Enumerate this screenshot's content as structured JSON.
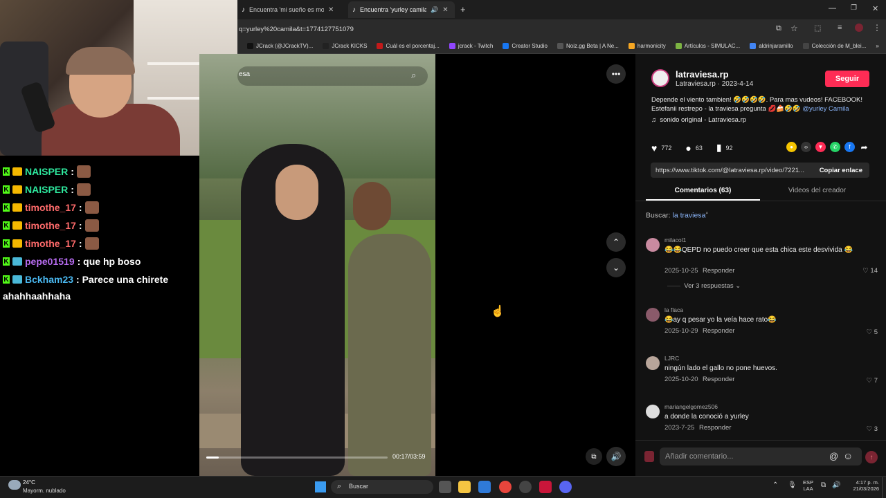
{
  "browser": {
    "tabs": [
      {
        "title": "Encuentra 'mi sueño es montar",
        "close": "✕"
      },
      {
        "title": "Encuentra 'yurley camila' en",
        "close": "✕"
      }
    ],
    "new_tab": "+",
    "url": "q=yurley%20camila&t=1774127751079",
    "bookmarks": [
      "JCrack (@JCrackTV)...",
      "JCrack KICKS",
      "Cuál es el porcentaj...",
      "jcrack - Twitch",
      "Creator Studio",
      "Noiz.gg Beta | A Ne...",
      "harmonicity",
      "Artículos - SIMULAC...",
      "aldrinjaramillo",
      "Colección de M_blei..."
    ],
    "bookmarks_more": "»"
  },
  "chat": {
    "messages": [
      {
        "user": "NAISPER",
        "color": "#2ee89e",
        "text": ":"
      },
      {
        "user": "NAISPER",
        "color": "#2ee89e",
        "text": ":"
      },
      {
        "user": "timothe_17",
        "color": "#ff6b6b",
        "text": ":"
      },
      {
        "user": "timothe_17",
        "color": "#ff6b6b",
        "text": ":"
      },
      {
        "user": "timothe_17",
        "color": "#ff6b6b",
        "text": ":"
      },
      {
        "user": "pepe01519",
        "color": "#b76cf0",
        "text": ": que hp boso"
      },
      {
        "user": "Bckham23",
        "color": "#4ab8f0",
        "text": ": Parece una chirete"
      }
    ],
    "continuation": "ahahhaahhaha"
  },
  "video": {
    "search_text": "esa",
    "time": "00:17/03:59",
    "progress": 0.07
  },
  "post": {
    "author": "latraviesa.rp",
    "author_meta": "Latraviesa.rp · 2023-4-14",
    "follow": "Seguir",
    "description": "Depende el viento tambien! 🤣🤣🤣🤣. Para mas vudeos! FACEBOOK! Estefanii restrepo - la traviesa pregunta 💋🍰🤣🤣",
    "mention": "@yurley Camila",
    "sound": "sonido original - Latraviesa.rp",
    "likes": "772",
    "comments": "63",
    "saves": "92",
    "link": "https://www.tiktok.com/@latraviesa.rp/video/7221...",
    "copy": "Copiar enlace",
    "tab_comments": "Comentarios (63)",
    "tab_videos": "Videos del creador",
    "search_prefix": "Buscar:",
    "search_query": "la traviesa"
  },
  "comments": [
    {
      "user": "milacol1",
      "text": "😂😂QEPD no puedo creer que esta chica este desvivida 😂",
      "date": "2025-10-25",
      "reply": "Responder",
      "likes": "14",
      "avatar": "#c98aa0"
    },
    {
      "user": "la flaca",
      "text": "😂ay q pesar yo la veía hace rato😂",
      "date": "2025-10-29",
      "reply": "Responder",
      "likes": "5",
      "avatar": "#8a5a6a"
    },
    {
      "user": "LJRC",
      "text": "ningún lado el gallo no pone huevos.",
      "date": "2025-10-20",
      "reply": "Responder",
      "likes": "7",
      "avatar": "#b8a59a"
    },
    {
      "user": "mariangelgomez506",
      "text": "a donde la conoció a yurley",
      "date": "2023-7-25",
      "reply": "Responder",
      "likes": "3",
      "avatar": "#ddd"
    }
  ],
  "more_replies": "Ver 3 respuestas",
  "comment_placeholder": "Añadir comentario...",
  "taskbar": {
    "temp": "24°C",
    "weather": "Mayorm. nublado",
    "search": "Buscar",
    "lang_top": "ESP",
    "lang_bottom": "LAA",
    "time": "4:17 p. m.",
    "date": "21/03/2026"
  }
}
